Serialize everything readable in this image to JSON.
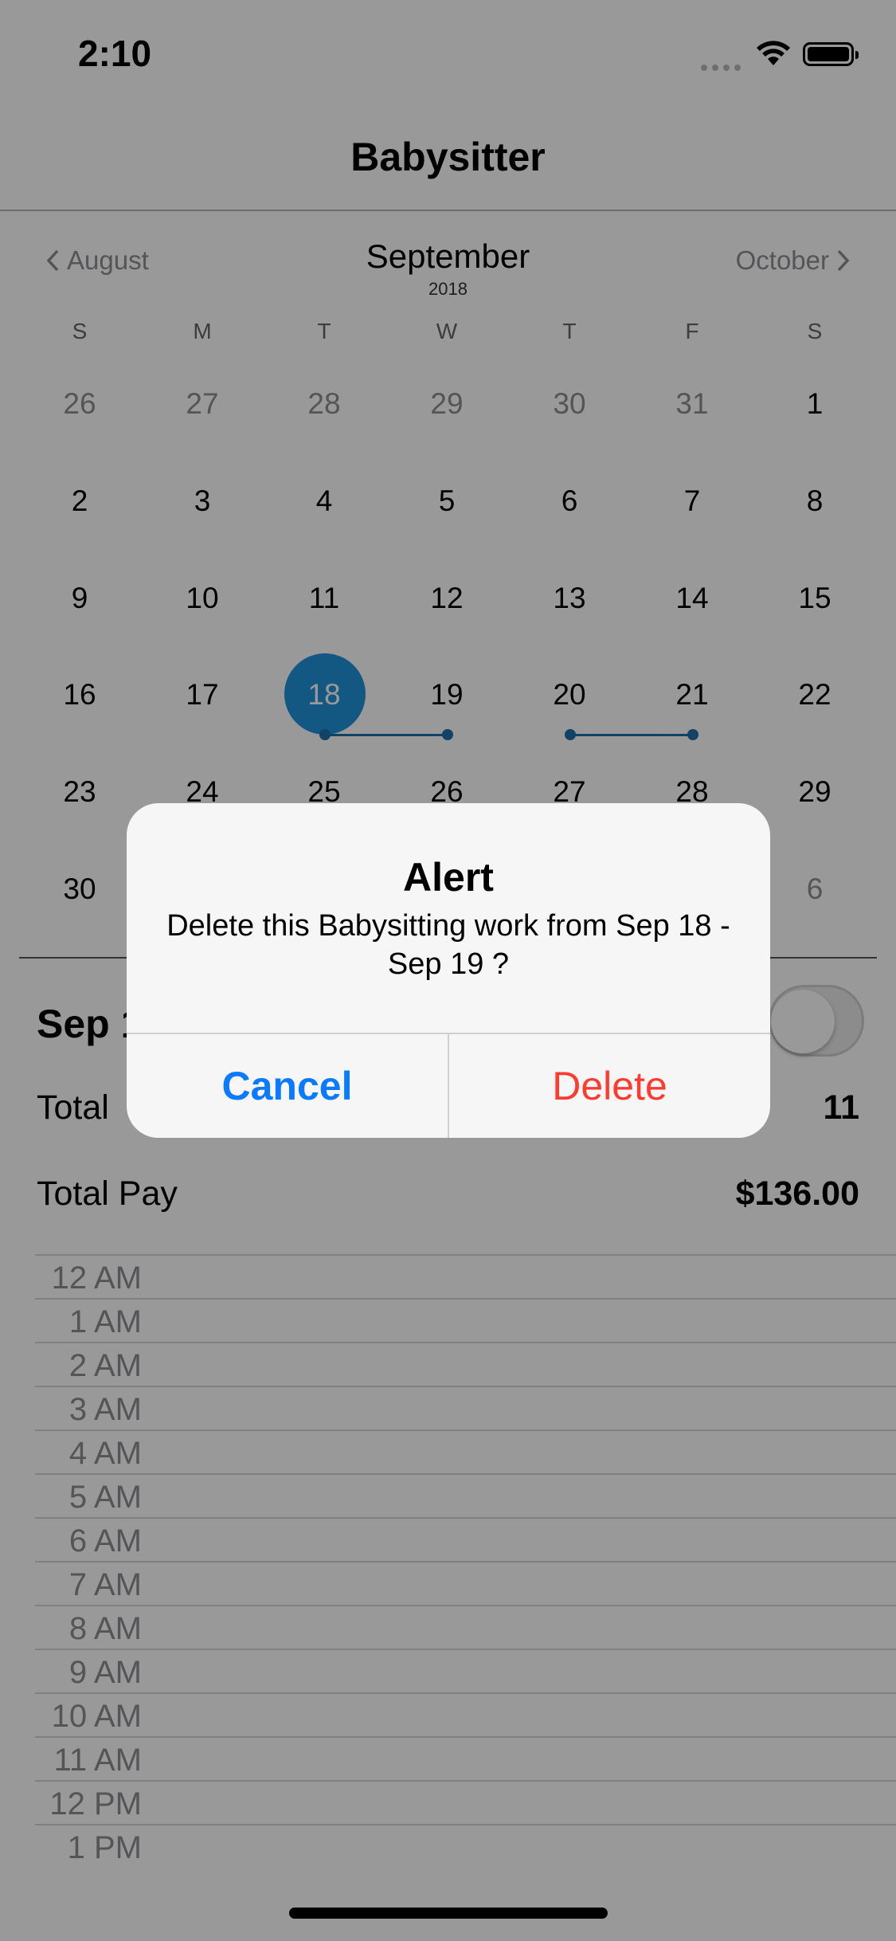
{
  "status_bar": {
    "time": "2:10"
  },
  "nav": {
    "title": "Babysitter"
  },
  "calendar": {
    "prev_month": "August",
    "next_month": "October",
    "month": "September",
    "year": "2018",
    "weekdays": [
      "S",
      "M",
      "T",
      "W",
      "T",
      "F",
      "S"
    ],
    "weeks": [
      [
        "26",
        "27",
        "28",
        "29",
        "30",
        "31",
        "1"
      ],
      [
        "2",
        "3",
        "4",
        "5",
        "6",
        "7",
        "8"
      ],
      [
        "9",
        "10",
        "11",
        "12",
        "13",
        "14",
        "15"
      ],
      [
        "16",
        "17",
        "18",
        "19",
        "20",
        "21",
        "22"
      ],
      [
        "23",
        "24",
        "25",
        "26",
        "27",
        "28",
        "29"
      ],
      [
        "30",
        "",
        "",
        "",
        "",
        "",
        "6"
      ]
    ],
    "selected_day": "18",
    "accent_color": "#1f93d9"
  },
  "details": {
    "date_label": "Sep 1",
    "total_hours_label": "Total",
    "total_hours_value": "11",
    "total_pay_label": "Total Pay",
    "total_pay_value": "$136.00"
  },
  "timeline": {
    "hours": [
      "12 AM",
      "1 AM",
      "2 AM",
      "3 AM",
      "4 AM",
      "5 AM",
      "6 AM",
      "7 AM",
      "8 AM",
      "9 AM",
      "10 AM",
      "11 AM",
      "12 PM",
      "1 PM"
    ]
  },
  "alert": {
    "title": "Alert",
    "message": "Delete this Babysitting work from Sep 18 - Sep 19 ?",
    "cancel_label": "Cancel",
    "delete_label": "Delete",
    "cancel_color": "#0a7bff",
    "delete_color": "#ff3b30"
  }
}
